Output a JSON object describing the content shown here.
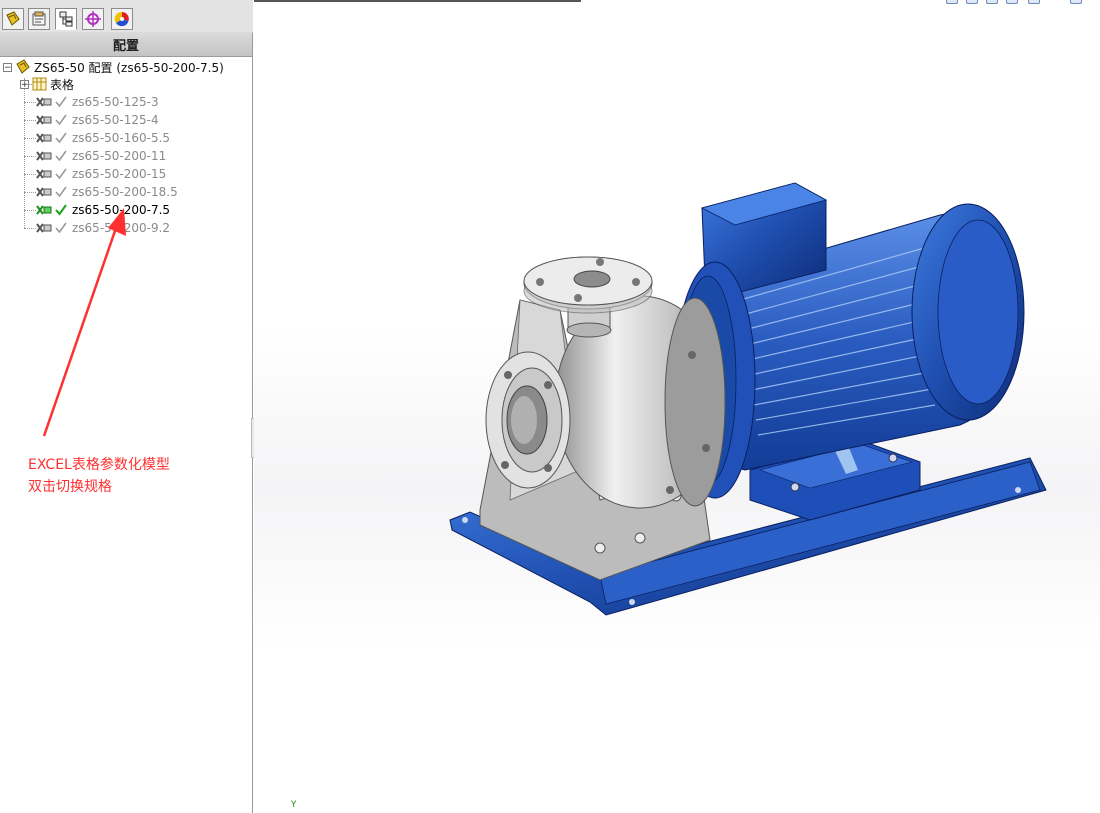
{
  "panel": {
    "tabs": [
      {
        "name": "feature-manager-tab",
        "icon": "feature-tree-icon"
      },
      {
        "name": "property-manager-tab",
        "icon": "property-icon"
      },
      {
        "name": "configuration-manager-tab",
        "icon": "configuration-icon"
      },
      {
        "name": "dimxpert-tab",
        "icon": "dimxpert-icon"
      },
      {
        "name": "display-manager-tab",
        "icon": "display-manager-icon"
      }
    ],
    "header": "配置"
  },
  "tree": {
    "root_label": "ZS65-50 配置  (zs65-50-200-7.5)",
    "table_label": "表格",
    "configs": [
      {
        "label": "zs65-50-125-3",
        "active": false
      },
      {
        "label": "zs65-50-125-4",
        "active": false
      },
      {
        "label": "zs65-50-160-5.5",
        "active": false
      },
      {
        "label": "zs65-50-200-11",
        "active": false
      },
      {
        "label": "zs65-50-200-15",
        "active": false
      },
      {
        "label": "zs65-50-200-18.5",
        "active": false
      },
      {
        "label": "zs65-50-200-7.5",
        "active": true
      },
      {
        "label": "zs65-50-200-9.2",
        "active": false
      }
    ]
  },
  "annotation": {
    "line1": "EXCEL表格参数化模型",
    "line2": "双击切换规格",
    "color": "#ff3030"
  },
  "viewport": {
    "axis_label": "Y",
    "model": "centrifugal-pump-with-motor"
  },
  "colors": {
    "motor_blue": "#1f4fb0",
    "pump_steel": "#c8c8c8",
    "check_active": "#1aa51a",
    "check_inactive": "#9a9a9a"
  }
}
